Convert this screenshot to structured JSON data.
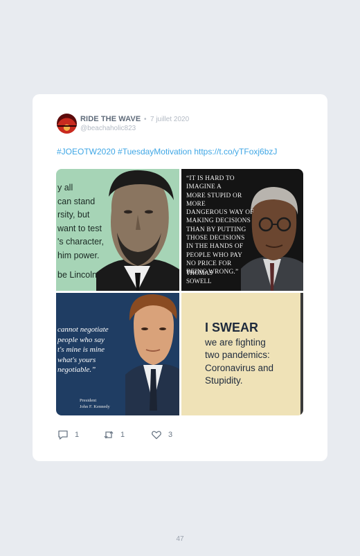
{
  "tweet": {
    "author_name": "RIDE THE WAVE",
    "separator": "•",
    "date": "7 juillet 2020",
    "handle": "@beachaholic823",
    "text_parts": [
      "#JOEOTW2020",
      "#TuesdayMotivation",
      "https://t.co/yTFoxj6bzJ"
    ]
  },
  "images": {
    "lincoln": {
      "lines": [
        "y all",
        "can stand",
        "rsity, but",
        "want to test",
        "'s character,",
        "him power."
      ],
      "attribution": "be Lincoln"
    },
    "sowell": {
      "lines": [
        "“It is hard to imagine a",
        "more stupid or more",
        "dangerous way of",
        "making decisions",
        "than by putting",
        "those decisions",
        "in the hands of",
        "people who pay",
        "no price for",
        "being wrong.”"
      ],
      "attribution_lines": [
        "Thomas",
        "Sowell"
      ]
    },
    "kennedy": {
      "lines": [
        "cannot negotiate",
        "people who say",
        "t's mine is mine",
        "what's yours",
        "negotiable.”"
      ],
      "attribution_lines": [
        "President",
        "John F. Kennedy"
      ]
    },
    "stupidity": {
      "title": "I SWEAR",
      "lines": [
        "we are fighting",
        "two pandemics:",
        "Coronavirus and",
        "Stupidity."
      ]
    }
  },
  "actions": {
    "reply_count": "1",
    "retweet_count": "1",
    "like_count": "3"
  },
  "page_number": "47",
  "colors": {
    "background": "#e8ebf0",
    "card": "#ffffff",
    "link": "#3ea6e5",
    "muted": "#b3bac4",
    "name": "#5f6b7a"
  },
  "icons": [
    "reply-icon",
    "retweet-icon",
    "heart-icon"
  ]
}
